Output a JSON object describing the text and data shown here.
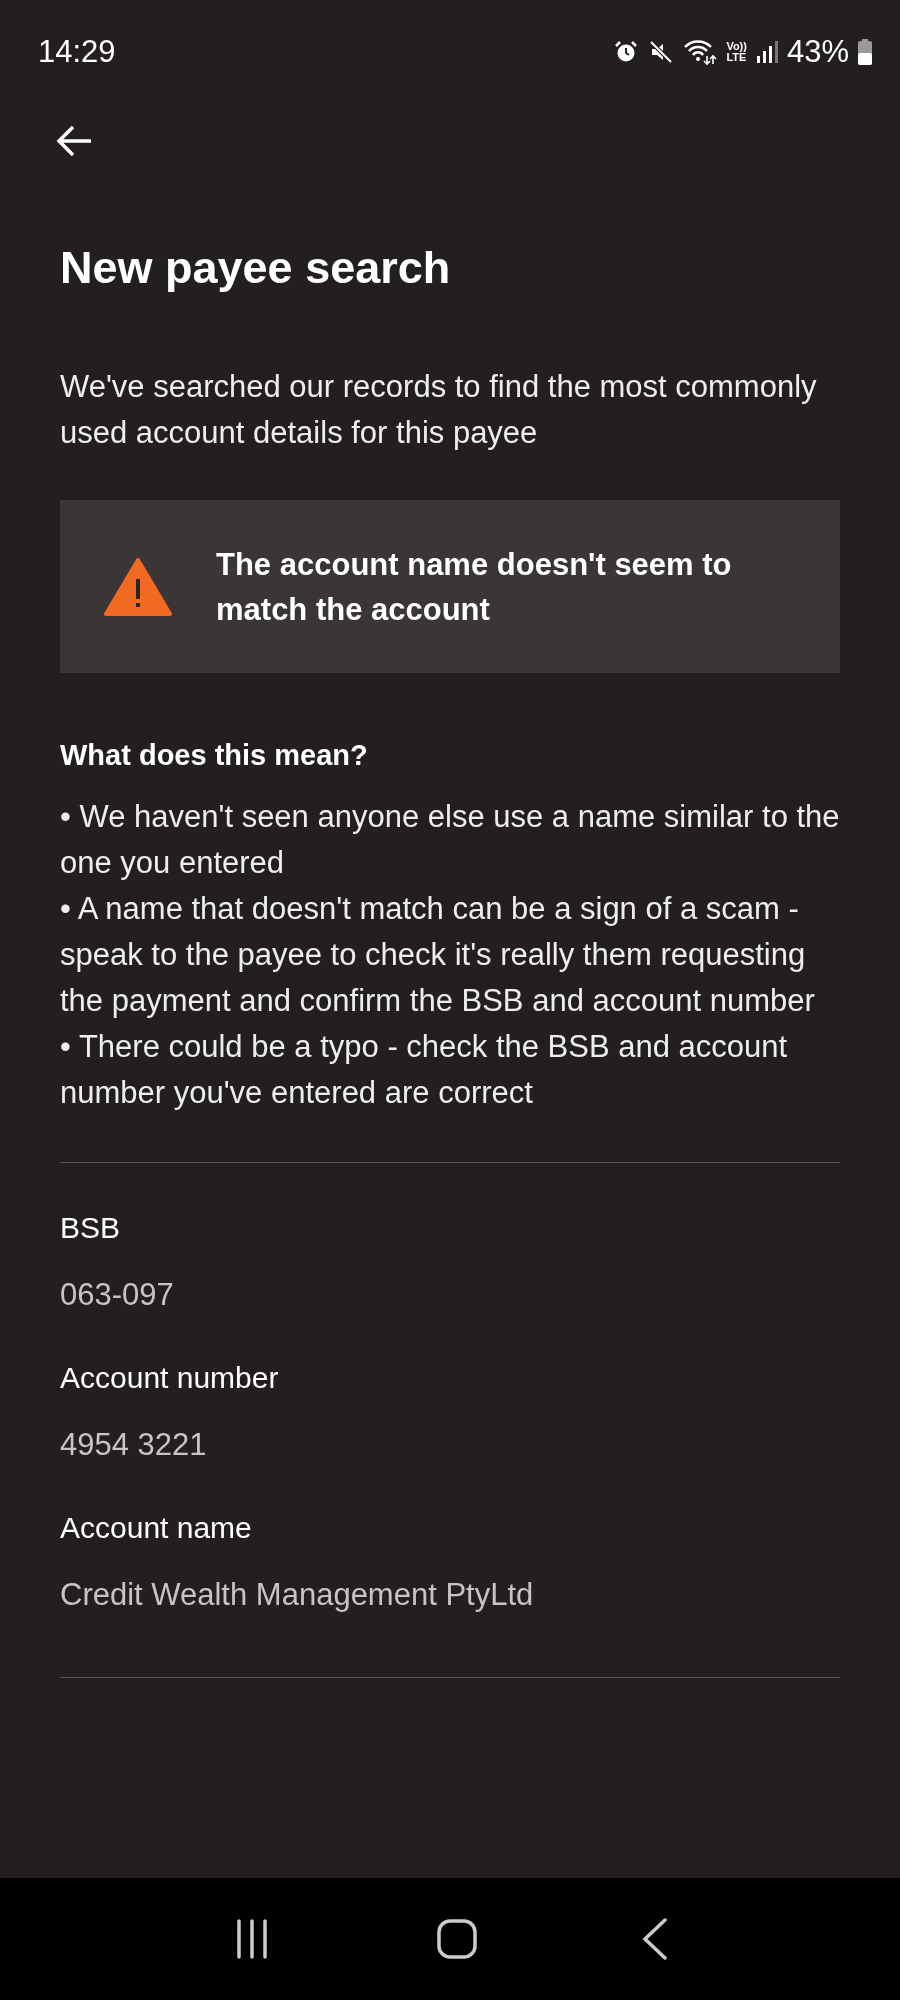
{
  "status_bar": {
    "time": "14:29",
    "network_top": "Vo))",
    "network_bottom": "LTE",
    "battery": "43%"
  },
  "title": "New payee search",
  "intro": "We've searched our records to find the most commonly used account details for this payee",
  "warning": {
    "message": "The account name doesn't seem to match the account"
  },
  "explanation": {
    "heading": "What does this mean?",
    "lines": [
      "• We haven't seen anyone else use a name similar to the one you entered",
      "• A name that doesn't match can be a sign of a scam - speak to the payee to check it's really them requesting the payment and confirm the BSB and account number",
      "• There could be a typo - check the BSB and account number you've entered are correct"
    ]
  },
  "details": [
    {
      "label": "BSB",
      "value": "063-097"
    },
    {
      "label": "Account number",
      "value": "4954 3221"
    },
    {
      "label": "Account name",
      "value": "Credit Wealth Management PtyLtd"
    }
  ]
}
